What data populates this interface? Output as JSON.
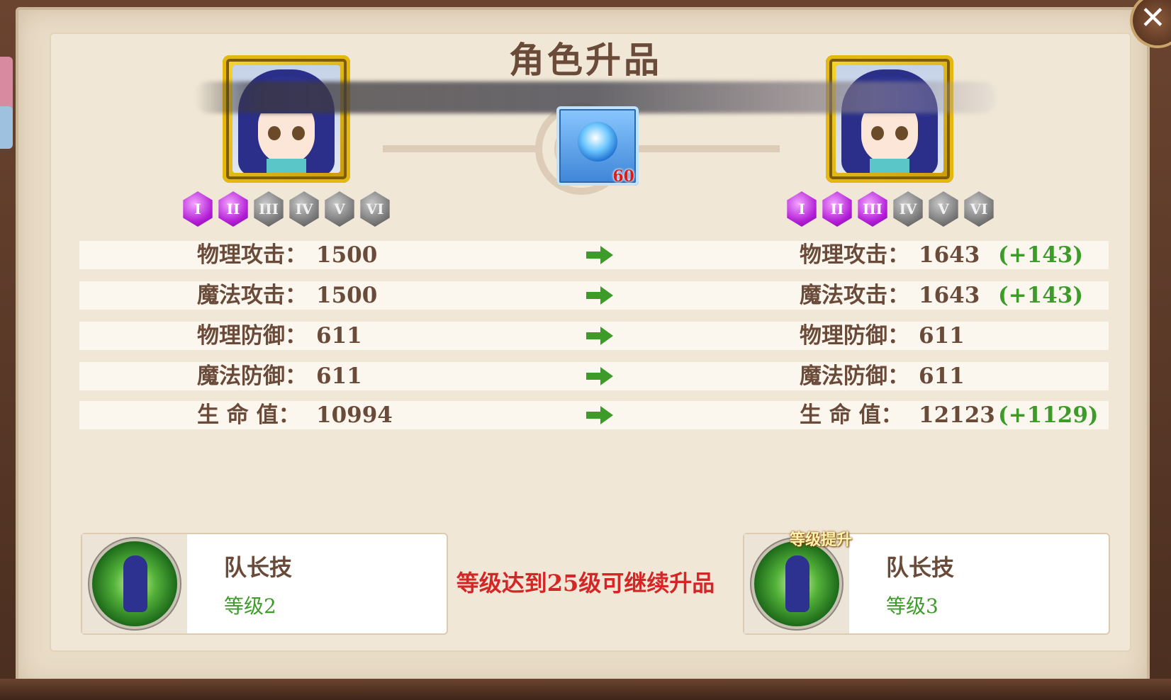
{
  "title": "角色升品",
  "close_icon": "close-icon",
  "left_grades": [
    "I",
    "II",
    "III",
    "IV",
    "V",
    "VI"
  ],
  "left_grades_active": 2,
  "right_grades": [
    "I",
    "II",
    "III",
    "IV",
    "V",
    "VI"
  ],
  "right_grades_active": 3,
  "item": {
    "icon": "upgrade-crystal-icon",
    "count": "60"
  },
  "stats": [
    {
      "label": "物理攻击：",
      "before": "1500",
      "after": "1643",
      "increase": "(+143)"
    },
    {
      "label": "魔法攻击：",
      "before": "1500",
      "after": "1643",
      "increase": "(+143)"
    },
    {
      "label": "物理防御：",
      "before": "611",
      "after": "611",
      "increase": ""
    },
    {
      "label": "魔法防御：",
      "before": "611",
      "after": "611",
      "increase": ""
    },
    {
      "label": "生 命 值：",
      "before": "10994",
      "after": "12123",
      "increase": "(+1129)"
    }
  ],
  "skill_left": {
    "name": "队长技",
    "level": "等级2"
  },
  "skill_right": {
    "name": "队长技",
    "level": "等级3",
    "badge": "等级提升"
  },
  "notice": "等级达到25级可继续升品",
  "colors": {
    "title": "#6a4a38",
    "increase": "#3d9b2a",
    "notice": "#d42626"
  }
}
